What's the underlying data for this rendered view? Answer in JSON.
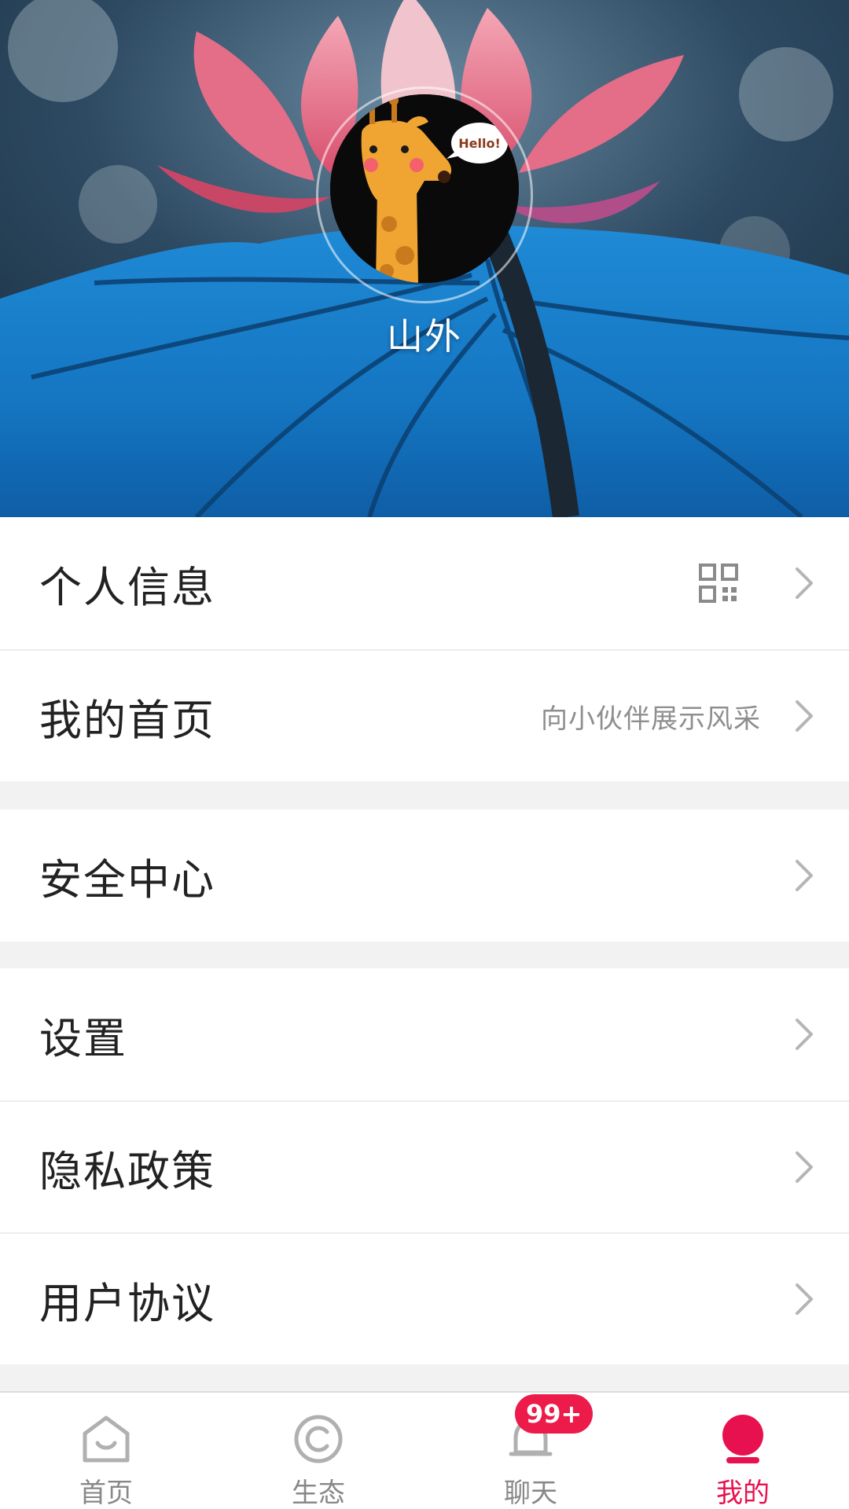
{
  "profile": {
    "nickname": "山外",
    "avatar_icon": "giraffe-avatar-icon",
    "avatar_speech": "Hello!",
    "cover_image": "lotus-flower-on-blue-leaf"
  },
  "menu": {
    "personal_info": {
      "label": "个人信息",
      "icon": "qr-code-icon"
    },
    "my_homepage": {
      "label": "我的首页",
      "subtitle": "向小伙伴展示风采"
    },
    "security_center": {
      "label": "安全中心"
    },
    "settings": {
      "label": "设置"
    },
    "privacy_policy": {
      "label": "隐私政策"
    },
    "user_agreement": {
      "label": "用户协议"
    }
  },
  "tabbar": {
    "home": {
      "label": "首页",
      "icon": "home-icon"
    },
    "ecology": {
      "label": "生态",
      "icon": "copyright-circle-icon"
    },
    "chat": {
      "label": "聊天",
      "icon": "bell-icon",
      "badge": "99+"
    },
    "mine": {
      "label": "我的",
      "icon": "profile-dot-icon",
      "active": true
    }
  },
  "colors": {
    "accent": "#e8114f",
    "badge": "#ec1b4a",
    "separator": "#f2f2f2"
  }
}
